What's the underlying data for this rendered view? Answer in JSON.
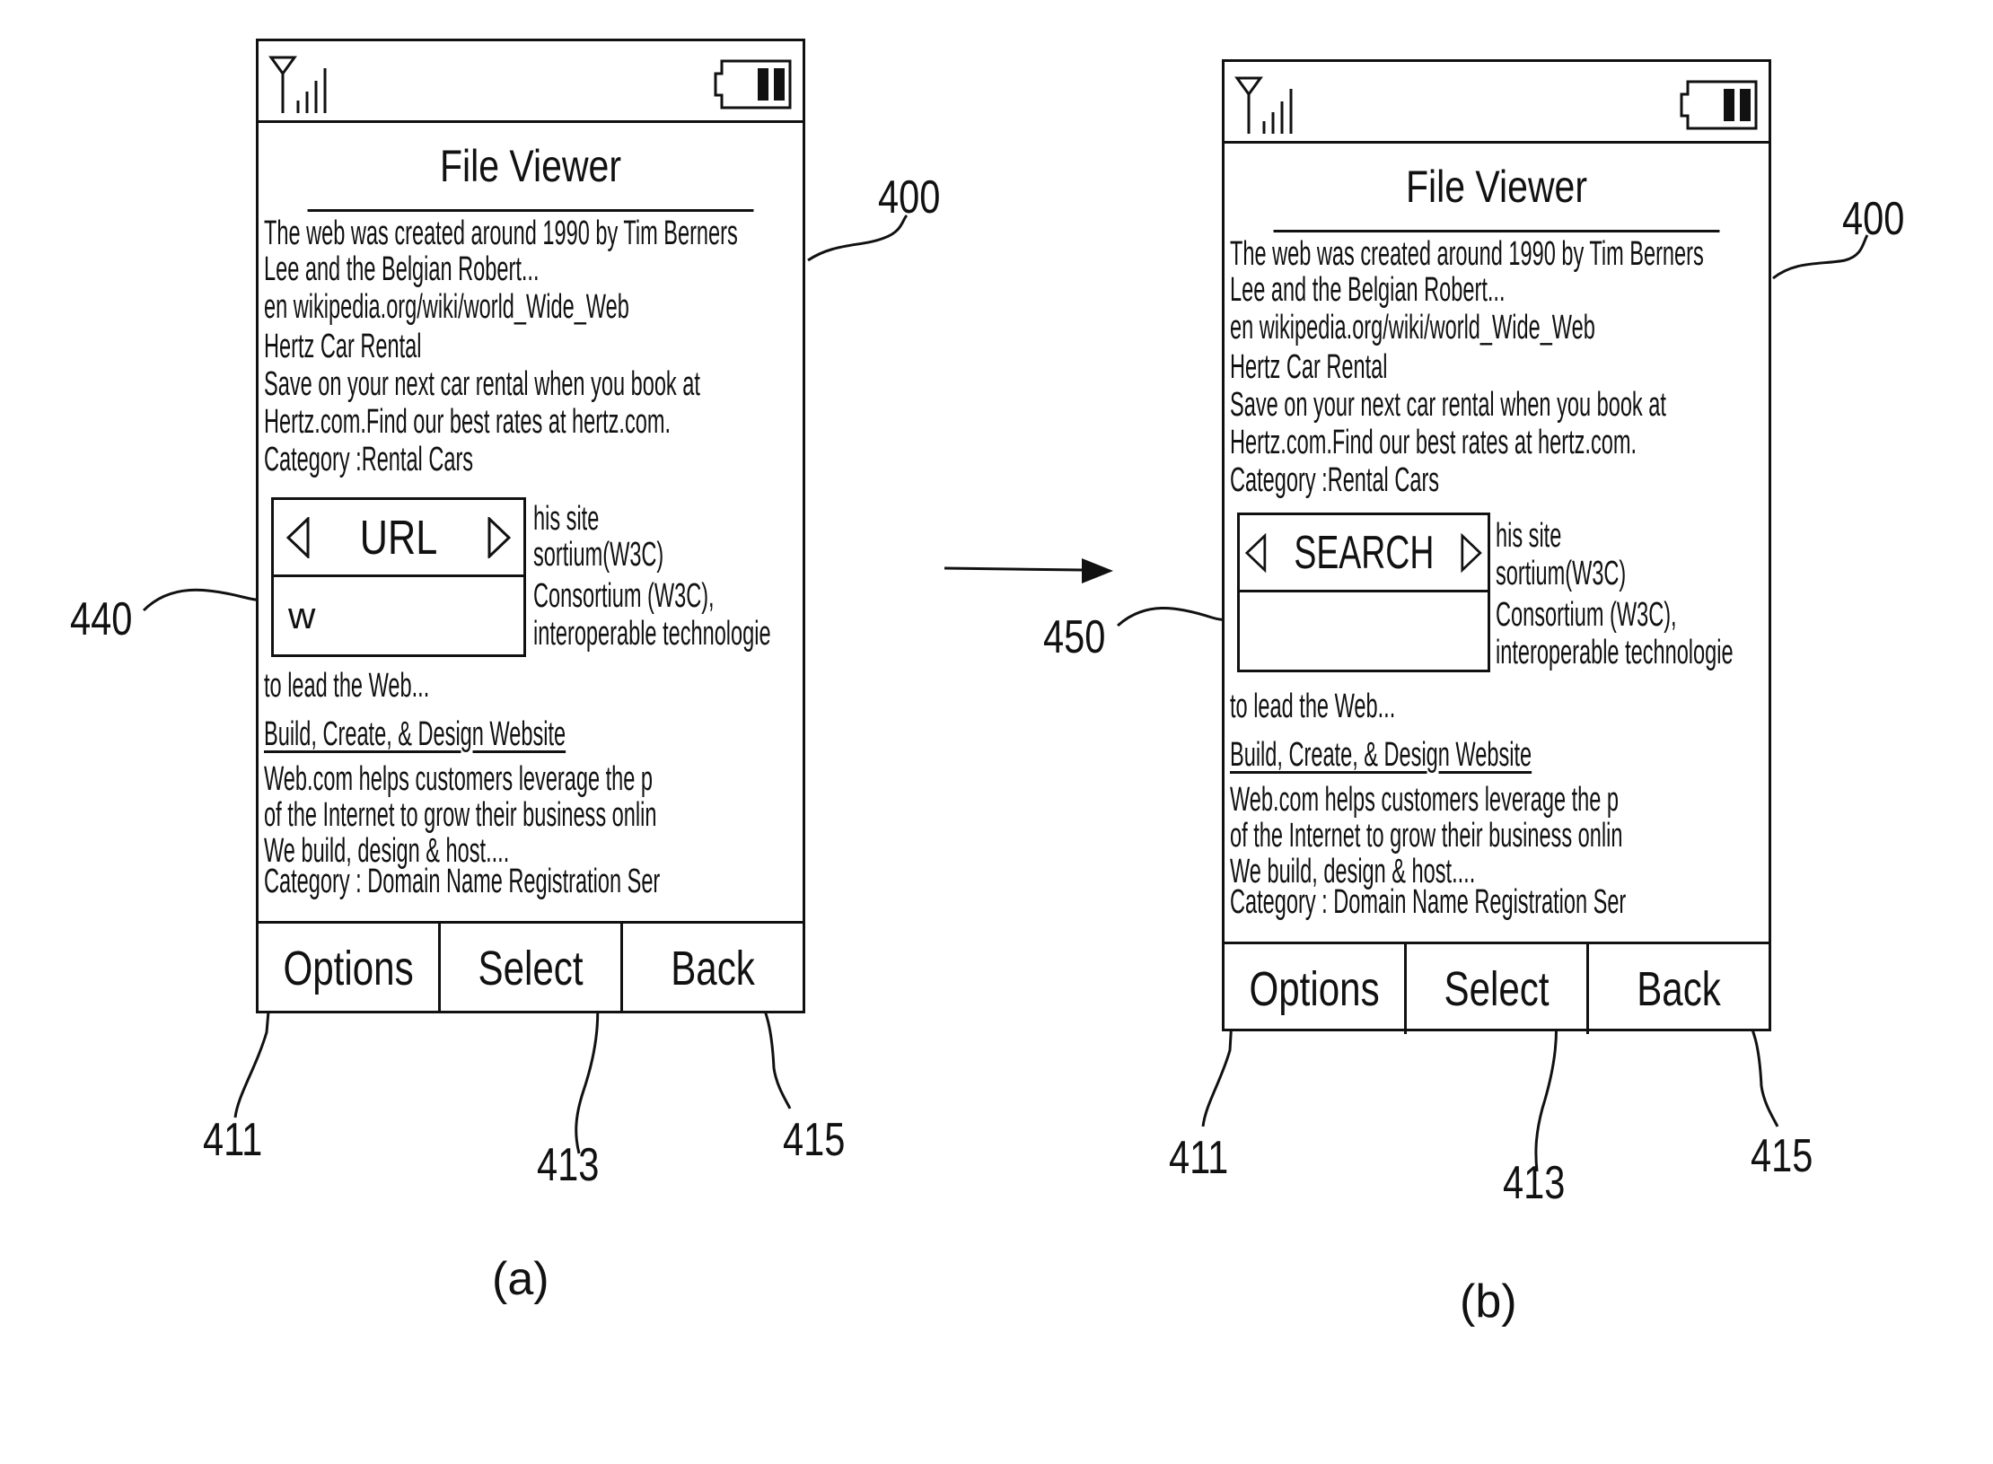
{
  "figure": {
    "captions": [
      "(a)",
      "(b)"
    ],
    "transition_arrow": "arrow-right"
  },
  "phones": [
    {
      "id": "a",
      "status": {
        "signal_icon": "antenna-signal-icon",
        "battery_icon": "battery-icon"
      },
      "title": "File Viewer",
      "content_lines": [
        "The web was created around 1990 by Tim Berners",
        "Lee and the Belgian Robert...",
        "en wikipedia.org/wiki/world_Wide_Web",
        "Hertz Car Rental",
        "Save on your next car rental when you book at",
        "Hertz.com.Find our best rates at hertz.com.",
        "Category :Rental Cars"
      ],
      "side_lines": [
        "his site",
        "sortium(W3C)",
        "Consortium (W3C),",
        "interoperable technologie"
      ],
      "after_lines": [
        "to lead the Web..."
      ],
      "link_title": "Build, Create, & Design Website",
      "tail_lines": [
        "Web.com helps customers leverage the p",
        "of the Internet to grow their business onlin",
        "We build, design & host....",
        "Category :  Domain Name Registration Ser"
      ],
      "popup": {
        "label": "URL",
        "prev_icon": "triangle-left-icon",
        "next_icon": "triangle-right-icon",
        "input_value": "w"
      },
      "softkeys": [
        "Options",
        "Select",
        "Back"
      ],
      "refs": {
        "device": "400",
        "popup": "440",
        "options": "411",
        "select": "413",
        "back": "415"
      }
    },
    {
      "id": "b",
      "status": {
        "signal_icon": "antenna-signal-icon",
        "battery_icon": "battery-icon"
      },
      "title": "File Viewer",
      "content_lines": [
        "The web was created around 1990 by Tim Berners",
        "Lee and the Belgian Robert...",
        "en wikipedia.org/wiki/world_Wide_Web",
        "Hertz Car Rental",
        "Save on your next car rental when you book at",
        "Hertz.com.Find our best rates at hertz.com.",
        "Category :Rental Cars"
      ],
      "side_lines": [
        "his site",
        "sortium(W3C)",
        "Consortium (W3C),",
        "interoperable technologie"
      ],
      "after_lines": [
        "to lead the Web..."
      ],
      "link_title": "Build, Create, & Design Website",
      "tail_lines": [
        "Web.com helps customers leverage the p",
        "of the Internet to grow their business onlin",
        "We build, design & host....",
        "Category :  Domain Name Registration Ser"
      ],
      "popup": {
        "label": "SEARCH",
        "prev_icon": "triangle-left-icon",
        "next_icon": "triangle-right-icon",
        "input_value": ""
      },
      "softkeys": [
        "Options",
        "Select",
        "Back"
      ],
      "refs": {
        "device": "400",
        "popup": "450",
        "options": "411",
        "select": "413",
        "back": "415"
      }
    }
  ]
}
